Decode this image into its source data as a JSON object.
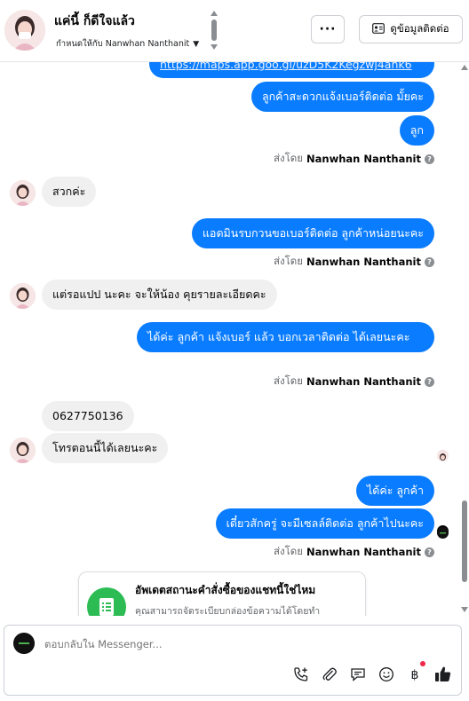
{
  "header": {
    "name": "แค่นี้ ก็ดีใจแล้ว",
    "assigned_text": "กำหนดให้กับ Nanwhan Nanthanit",
    "more_label": "···",
    "contact_button_label": "ดูข้อมูลติดต่อ"
  },
  "messages": {
    "link_partial": "https://maps.app.goo.gl/uzD5K2Kegzwj4ahk6",
    "out_1": "ลูกค้าสะดวกแจ้งเบอร์ติดต่อ มั้ยคะ",
    "out_2": "ลูก",
    "in_1": "สวกค่ะ",
    "out_3": "แอดมินรบกวนขอเบอร์ติดต่อ ลูกค้าหน่อยนะคะ",
    "in_2": "แต่รอแปป นะคะ จะให้น้อง คุยรายละเอียดคะ",
    "out_4": "ได้ค่ะ  ลูกค้า แจ้งเบอร์ แล้ว บอกเวลาติดต่อ ได้เลยนะคะ",
    "in_3": "0627750136",
    "in_4": "โทรตอนนี้ได้เลยนะคะ",
    "out_5": "ได้ค่ะ  ลูกค้า",
    "out_6": "เดี๋ยวสักครู่ จะมีเซลล์ติดต่อ ลูกค้าไปนะคะ"
  },
  "sent_by": {
    "prefix": "ส่งโดย",
    "agent": "Nanwhan Nanthanit"
  },
  "card": {
    "title": "อัพเดตสถานะคำสั่งซื้อของแชทนี้ใช่ไหม",
    "description": "คุณสามารถจัดระเบียบกล่องข้อความได้โดยทำ"
  },
  "composer": {
    "placeholder": "ตอบกลับใน Messenger..."
  },
  "colors": {
    "outgoing_bubble": "#0a7cff",
    "incoming_bubble": "#f0f0f0",
    "card_icon": "#2dbb54",
    "like_icon": "#1c1e21",
    "notification_dot": "#f02849"
  },
  "icons": [
    "more-dots-icon",
    "contact-card-icon",
    "caret-down-icon",
    "info-icon",
    "order-list-icon",
    "phone-add-icon",
    "attach-icon",
    "saved-reply-icon",
    "emoji-icon",
    "baht-icon",
    "thumbs-up-icon"
  ]
}
